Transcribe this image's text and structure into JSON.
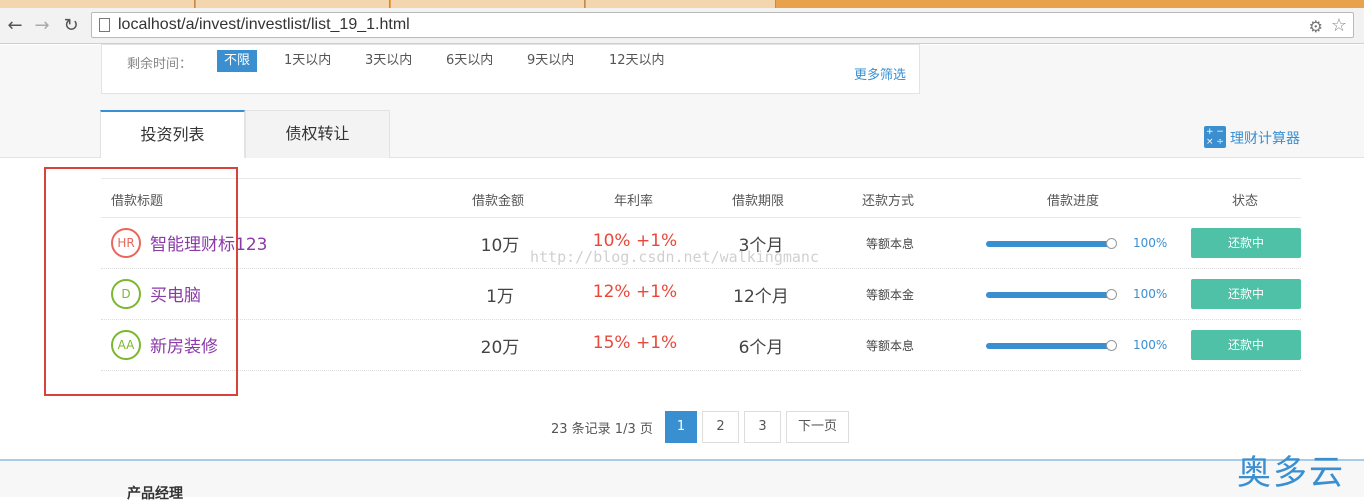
{
  "browser": {
    "url": "localhost/a/invest/investlist/list_19_1.html"
  },
  "filter": {
    "label": "剩余时间：",
    "options": [
      "不限",
      "1天以内",
      "3天以内",
      "6天以内",
      "9天以内",
      "12天以内"
    ],
    "selected": "不限",
    "more": "更多筛选"
  },
  "tabs": [
    {
      "label": "投资列表",
      "active": true
    },
    {
      "label": "债权转让",
      "active": false
    }
  ],
  "calculator": {
    "label": "理财计算器",
    "icon": "calculator-icon"
  },
  "table": {
    "headers": [
      "借款标题",
      "借款金额",
      "年利率",
      "借款期限",
      "还款方式",
      "借款进度",
      "状态"
    ],
    "rows": [
      {
        "badge": "HR",
        "badge_color": "#e8675a",
        "title": "智能理财标123",
        "amount": "10万",
        "rate": "10% +1%",
        "term": "3个月",
        "method": "等额本息",
        "progress": 1.0,
        "progress_text": "100%",
        "status": "还款中"
      },
      {
        "badge": "D",
        "badge_color": "#7cb82f",
        "title": "买电脑",
        "amount": "1万",
        "rate": "12% +1%",
        "term": "12个月",
        "method": "等额本金",
        "progress": 1.0,
        "progress_text": "100%",
        "status": "还款中"
      },
      {
        "badge": "AA",
        "badge_color": "#7cb82f",
        "title": "新房装修",
        "amount": "20万",
        "rate": "15% +1%",
        "term": "6个月",
        "method": "等额本息",
        "progress": 1.0,
        "progress_text": "100%",
        "status": "还款中"
      }
    ]
  },
  "watermark": "http://blog.csdn.net/walkingmanc",
  "pagination": {
    "summary": "23 条记录 1/3 页",
    "pages": [
      "1",
      "2",
      "3"
    ],
    "current": "1",
    "next": "下一页"
  },
  "footer": {
    "title": "产品经理"
  },
  "logo": "奥多云",
  "colors": {
    "accent": "#3a8fd1",
    "rate": "#e8483b",
    "status": "#4fc1a6",
    "highlight": "#d9413a"
  }
}
